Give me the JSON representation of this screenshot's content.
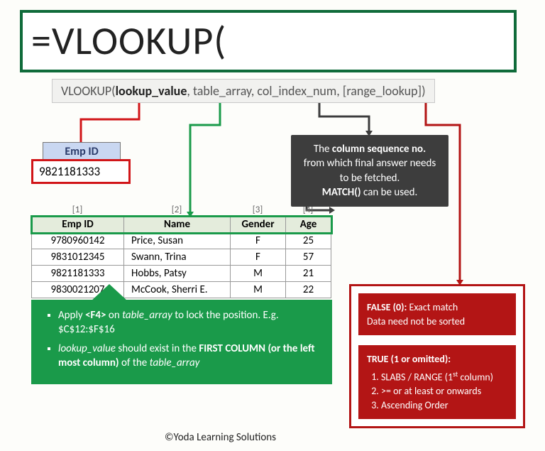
{
  "formula": "=VLOOKUP(",
  "syntax": {
    "fn": "VLOOKUP(",
    "arg1": "lookup_value",
    "sep1": ", ",
    "arg2": "table_array",
    "sep2": ", ",
    "arg3": "col_index_num",
    "sep3": ", ",
    "arg4": "[range_lookup]",
    "close": ")"
  },
  "lookup": {
    "label": "Emp ID",
    "value": "9821181333"
  },
  "col_indices": {
    "c1": "[1]",
    "c2": "[2]",
    "c3": "[3]",
    "c4": "[4]"
  },
  "table": {
    "headers": {
      "emp": "Emp ID",
      "name": "Name",
      "gender": "Gender",
      "age": "Age"
    },
    "rows": [
      {
        "emp": "9780960142",
        "name": "Price, Susan",
        "gender": "F",
        "age": "25"
      },
      {
        "emp": "9831012345",
        "name": "Swann, Trina",
        "gender": "F",
        "age": "57"
      },
      {
        "emp": "9821181333",
        "name": "Hobbs, Patsy",
        "gender": "M",
        "age": "21"
      },
      {
        "emp": "9830021207",
        "name": "McCook, Sherri E.",
        "gender": "M",
        "age": "22"
      }
    ]
  },
  "green_tips": {
    "t1a": "Apply ",
    "t1b": "<F4>",
    "t1c": " on ",
    "t1d": "table_array",
    "t1e": " to lock the position. E.g. $C$12:$F$16",
    "t2a": "lookup_value",
    "t2b": " should exist in the ",
    "t2c": "FIRST COLUMN (or the left most column)",
    "t2d": " of the ",
    "t2e": "table_array"
  },
  "grey_tip": {
    "l1a": "The ",
    "l1b": "column sequence no.",
    "l2": "from which final answer needs to be fetched.",
    "l3a": "MATCH()",
    "l3b": " can be used."
  },
  "red_tip": {
    "false_title": "FALSE (0):",
    "false_l1": " Exact match",
    "false_l2": "Data need not be sorted",
    "true_title": "TRUE (1 or omitted):",
    "true_1a": "SLABS / RANGE (1",
    "true_1b": "st",
    "true_1c": " column)",
    "true_2": ">= or at least or onwards",
    "true_3": "Ascending Order"
  },
  "copyright": "©Yoda Learning Solutions"
}
